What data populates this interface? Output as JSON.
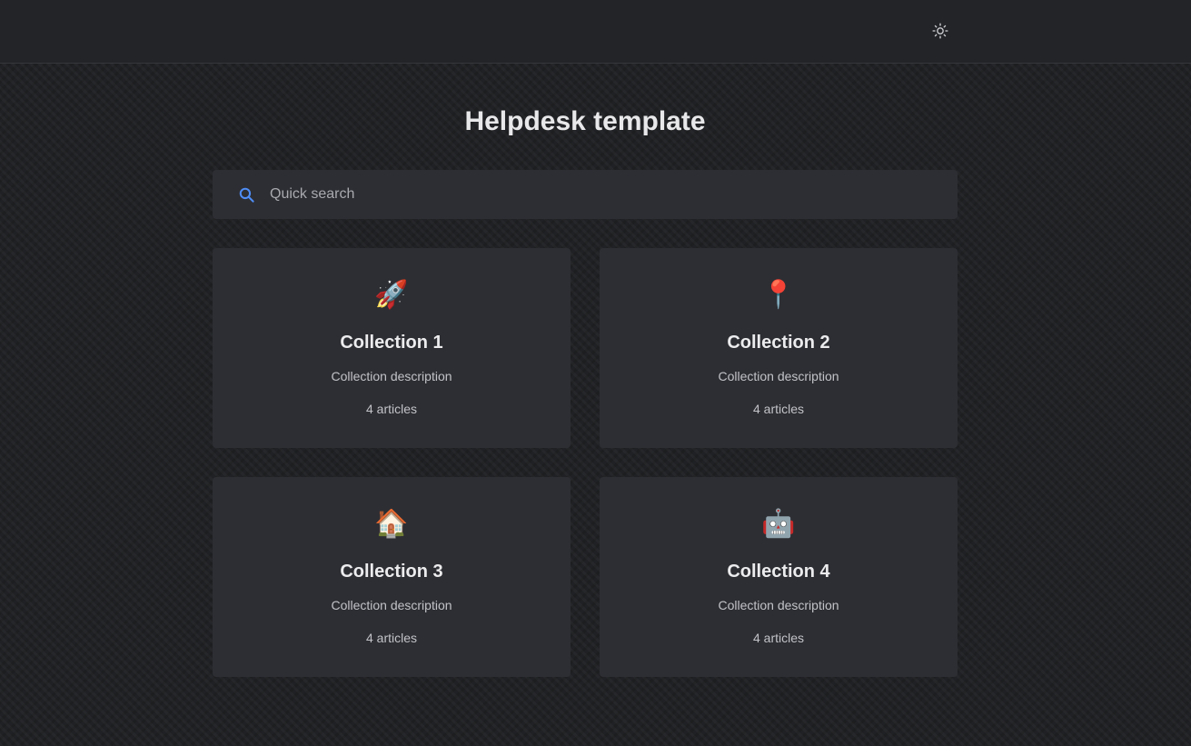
{
  "header": {
    "theme_toggle_icon": "sun-icon"
  },
  "main": {
    "title": "Helpdesk template",
    "search": {
      "placeholder": "Quick search",
      "value": "",
      "icon": "search-icon",
      "icon_color": "#4f8df5"
    },
    "collections": [
      {
        "emoji": "🚀",
        "icon": "rocket-icon",
        "title": "Collection 1",
        "description": "Collection description",
        "count": "4 articles"
      },
      {
        "emoji": "📍",
        "icon": "pin-icon",
        "title": "Collection 2",
        "description": "Collection description",
        "count": "4 articles"
      },
      {
        "emoji": "🏠",
        "icon": "house-icon",
        "title": "Collection 3",
        "description": "Collection description",
        "count": "4 articles"
      },
      {
        "emoji": "🤖",
        "icon": "robot-icon",
        "title": "Collection 4",
        "description": "Collection description",
        "count": "4 articles"
      }
    ]
  },
  "colors": {
    "background": "#202124",
    "surface": "#2d2e33",
    "topbar": "#232428"
  }
}
